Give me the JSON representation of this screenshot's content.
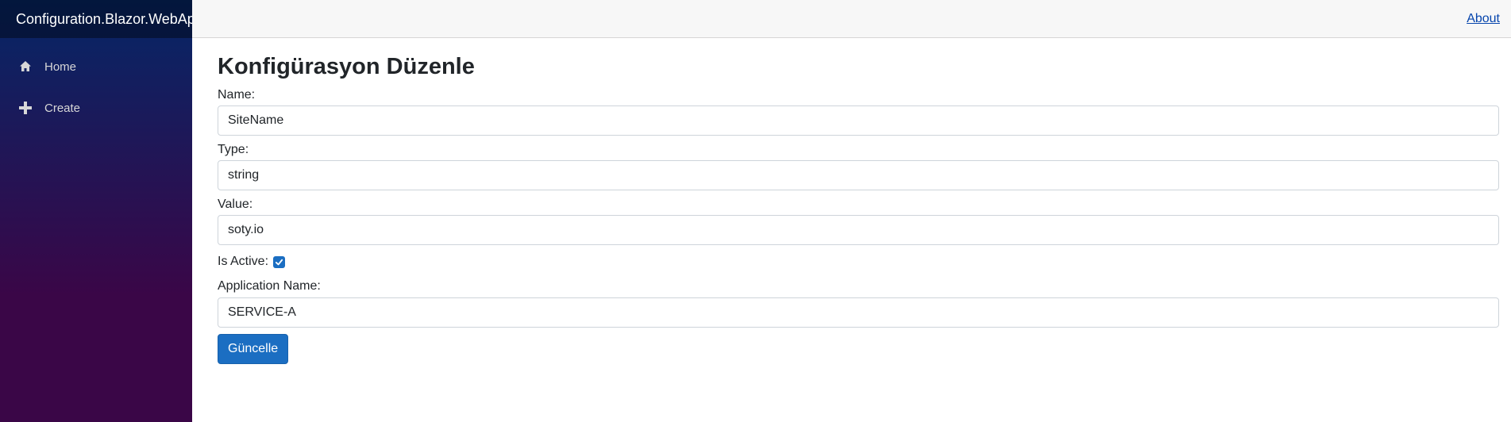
{
  "app": {
    "brand": "Configuration.Blazor.WebApp"
  },
  "sidebar": {
    "items": [
      {
        "label": "Home",
        "icon": "home-icon"
      },
      {
        "label": "Create",
        "icon": "plus-icon"
      }
    ]
  },
  "topbar": {
    "about_label": "About"
  },
  "colors": {
    "accent": "#1b6ec2",
    "sidebar_top": "#052767",
    "sidebar_bottom": "#3a0647"
  },
  "form": {
    "title": "Konfigürasyon Düzenle",
    "name_label": "Name:",
    "name_value": "SiteName",
    "type_label": "Type:",
    "type_value": "string",
    "value_label": "Value:",
    "value_value": "soty.io",
    "active_label": "Is Active:",
    "is_active": true,
    "app_name_label": "Application Name:",
    "app_name_value": "SERVICE-A",
    "submit_label": "Güncelle"
  }
}
